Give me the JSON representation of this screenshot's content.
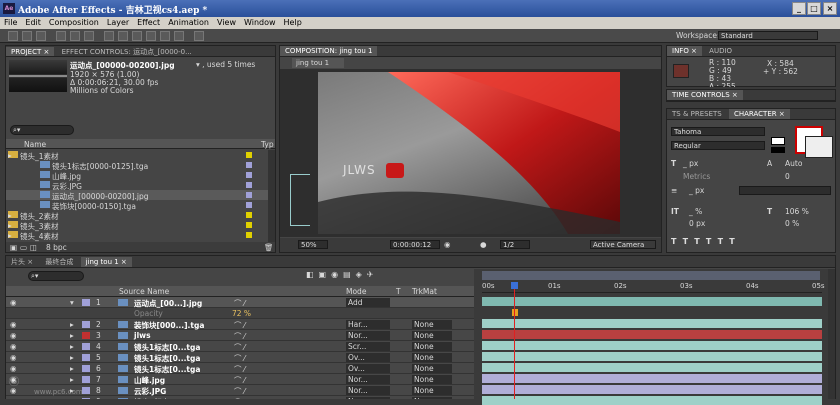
{
  "window": {
    "title": "Adobe After Effects - 吉林卫视cs4.aep *",
    "min": "_",
    "max": "□",
    "close": "×"
  },
  "menu": [
    "File",
    "Edit",
    "Composition",
    "Layer",
    "Effect",
    "Animation",
    "View",
    "Window",
    "Help"
  ],
  "workspace": {
    "label": "Workspace:",
    "value": "Standard"
  },
  "project": {
    "tab": "PROJECT ×",
    "tab2": "EFFECT CONTROLS: 运动点_[0000-0...",
    "item_name": "运动点_[00000-00200].jpg",
    "used": "▾ , used 5 times",
    "dims": "1920 × 576 (1.00)",
    "duration": "Δ 0:00:06:21, 30.00 fps",
    "colors": "Millions of Colors",
    "col_name": "Name",
    "col_type": "Typ",
    "items": [
      {
        "name": "镜头_1素材",
        "kind": "folder",
        "color": "#e0d000"
      },
      {
        "name": "镜头1标志[0000-0125].tga",
        "kind": "file",
        "color": "#a0a0d8"
      },
      {
        "name": "山峰.jpg",
        "kind": "file",
        "color": "#a0a0d8"
      },
      {
        "name": "云彩.JPG",
        "kind": "file",
        "color": "#a0a0d8"
      },
      {
        "name": "运动点_[00000-00200].jpg",
        "kind": "file",
        "color": "#a0a0d8"
      },
      {
        "name": "装饰块[0000-0150].tga",
        "kind": "file",
        "color": "#a0a0d8"
      },
      {
        "name": "镜头_2素材",
        "kind": "folder",
        "color": "#e0d000"
      },
      {
        "name": "镜头_3素材",
        "kind": "folder",
        "color": "#e0d000"
      },
      {
        "name": "镜头_4素材",
        "kind": "folder",
        "color": "#e0d000"
      }
    ],
    "bpc": "8 bpc"
  },
  "composition": {
    "tab": "COMPOSITION: jing tou 1",
    "subtab": "jing tou 1",
    "logo_text": "JLWS",
    "zoom": "50%",
    "timecode": "0:00:00:12",
    "resolution": "1/2",
    "view": "Active Camera"
  },
  "info": {
    "tab": "INFO ×",
    "tab2": "AUDIO",
    "r": "R : 110",
    "g": "G : 49",
    "b": "B : 43",
    "a": "A : 255",
    "x": "X : 584",
    "y": "+ Y : 562",
    "swatch": "#6e312b"
  },
  "time_controls": {
    "tab": "TIME CONTROLS ×"
  },
  "character": {
    "tab1": "TS & PRESETS",
    "tab2": "CHARACTER ×",
    "font": "Tahoma",
    "style": "Regular",
    "size": "_ px",
    "leading": "Auto",
    "kerning": "Metrics",
    "tracking": "0",
    "stroke": "_ px",
    "vscale": "_ %",
    "hscale": "106 %",
    "baseline": "0 px",
    "tsume": "0 %"
  },
  "timeline": {
    "tabs": [
      "片头 ×",
      "最终合成",
      "jing tou 1 ×"
    ],
    "col_source": "Source Name",
    "col_mode": "Mode",
    "col_t": "T",
    "col_trkmat": "TrkMat",
    "ruler": [
      "00s",
      "01s",
      "02s",
      "03s",
      "04s",
      "05s"
    ],
    "opacity_label": "Opacity",
    "opacity_value": "72 %",
    "layers": [
      {
        "num": "1",
        "name": "运动点_[00...].jpg",
        "mode": "Add",
        "trk": "",
        "color": "#a0a0d8",
        "bar": "#7fb9b0"
      },
      {
        "num": "2",
        "name": "装饰块[000...].tga",
        "mode": "Har...",
        "trk": "None",
        "color": "#a0a0d8",
        "bar": "#9ed0c8"
      },
      {
        "num": "3",
        "name": "jlws",
        "mode": "Nor...",
        "trk": "None",
        "color": "#c03030",
        "bar": "#b84040"
      },
      {
        "num": "4",
        "name": "镜头1标志[0...tga",
        "mode": "Scr...",
        "trk": "None",
        "color": "#a0a0d8",
        "bar": "#9ed0c8"
      },
      {
        "num": "5",
        "name": "镜头1标志[0...tga",
        "mode": "Ov...",
        "trk": "None",
        "color": "#a0a0d8",
        "bar": "#9ed0c8"
      },
      {
        "num": "6",
        "name": "镜头1标志[0...tga",
        "mode": "Ov...",
        "trk": "None",
        "color": "#a0a0d8",
        "bar": "#9ed0c8"
      },
      {
        "num": "7",
        "name": "山峰.jpg",
        "mode": "Nor...",
        "trk": "None",
        "color": "#a0a0d8",
        "bar": "#b0aed8"
      },
      {
        "num": "8",
        "name": "云彩.JPG",
        "mode": "Nor...",
        "trk": "None",
        "color": "#a0a0d8",
        "bar": "#b0aed8"
      },
      {
        "num": "9",
        "name": "镜头1标志[0...tga",
        "mode": "Nor...",
        "trk": "None",
        "color": "#a0a0d8",
        "bar": "#9ed0c8"
      }
    ],
    "watermark": "www.pc6.com"
  }
}
